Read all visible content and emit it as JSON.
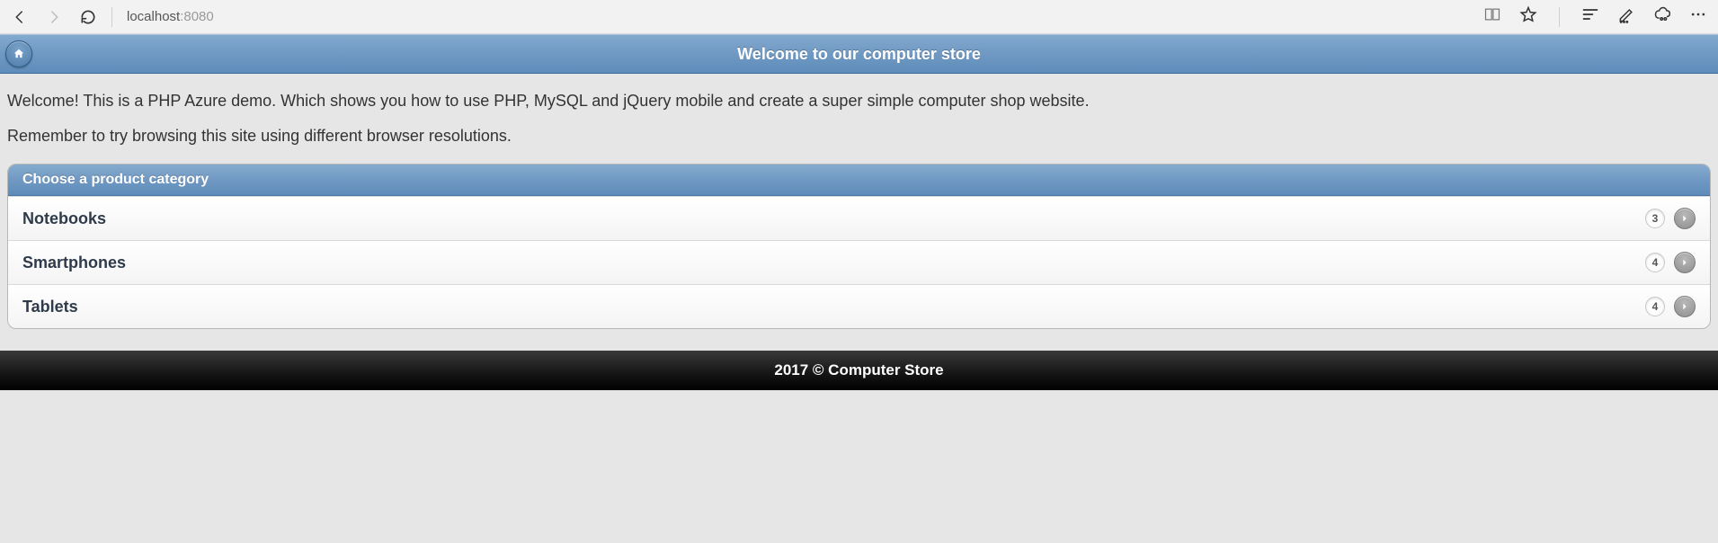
{
  "browser": {
    "address_host": "localhost",
    "address_port": ":8080"
  },
  "header": {
    "title": "Welcome to our computer store"
  },
  "intro": {
    "p1": "Welcome! This is a PHP Azure demo. Which shows you how to use PHP, MySQL and jQuery mobile and create a super simple computer shop website.",
    "p2": "Remember to try browsing this site using different browser resolutions."
  },
  "list": {
    "heading": "Choose a product category",
    "items": [
      {
        "label": "Notebooks",
        "count": "3"
      },
      {
        "label": "Smartphones",
        "count": "4"
      },
      {
        "label": "Tablets",
        "count": "4"
      }
    ]
  },
  "footer": {
    "text": "2017 © Computer Store"
  }
}
